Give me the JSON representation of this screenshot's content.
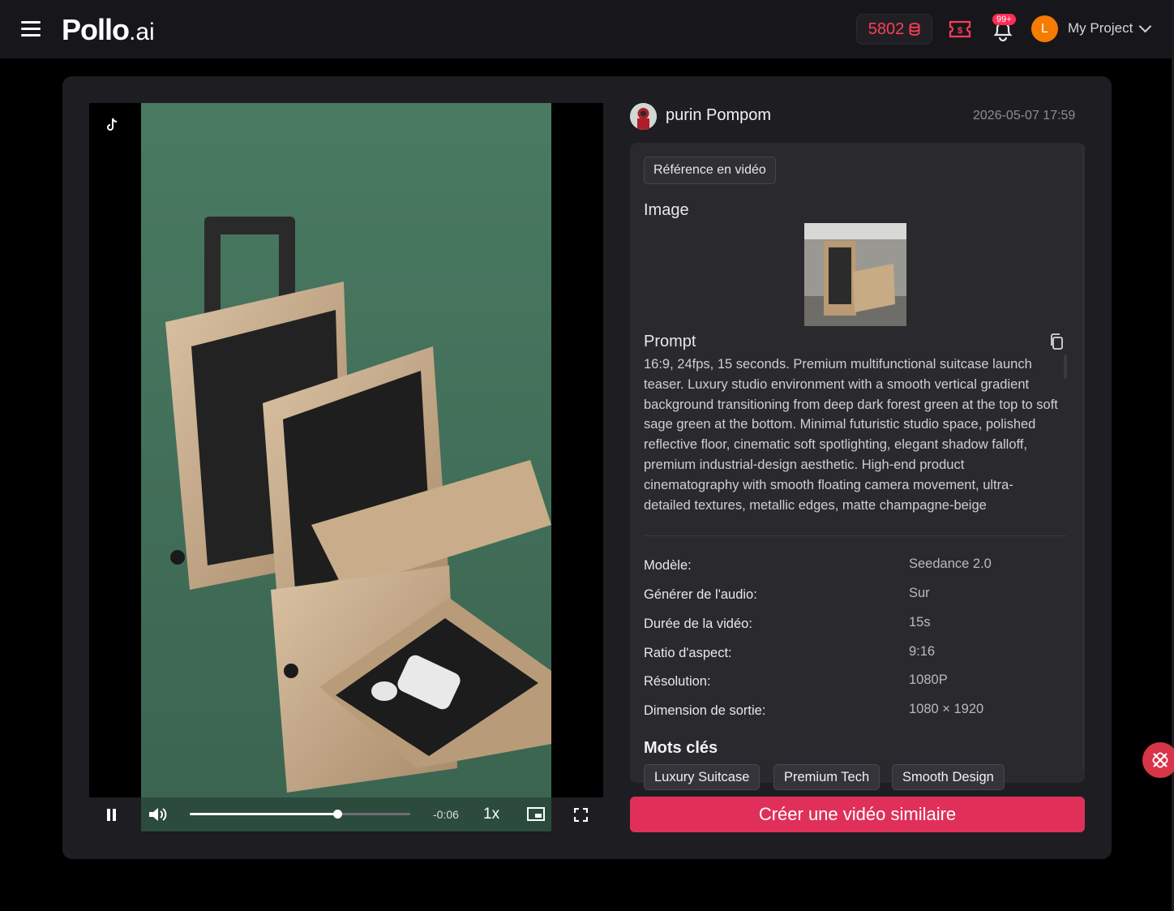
{
  "header": {
    "logo_main": "Pollo",
    "logo_ai": ".ai",
    "credits": "5802",
    "notifications_badge": "99+",
    "user_initial": "L",
    "project_label": "My Project"
  },
  "video": {
    "time_remaining": "-0:06",
    "speed": "1x",
    "progress": 0.67
  },
  "post": {
    "author": "purin Pompom",
    "date": "2026-05-07 17:59",
    "mode_tag": "Référence en vidéo",
    "image_label": "Image",
    "prompt_label": "Prompt",
    "prompt_text": "16:9, 24fps, 15 seconds. Premium multifunctional suitcase launch teaser. Luxury studio environment with a smooth vertical gradient background transitioning from deep dark forest green at the top to soft sage green at the bottom. Minimal futuristic studio space, polished reflective floor, cinematic soft spotlighting, elegant shadow falloff, premium industrial-design aesthetic. High-end product cinematography with smooth floating camera movement, ultra-detailed textures, metallic edges, matte champagne-beige"
  },
  "specs": [
    {
      "label": "Modèle:",
      "value": "Seedance 2.0"
    },
    {
      "label": "Générer de l'audio:",
      "value": "Sur"
    },
    {
      "label": "Durée de la vidéo:",
      "value": "15s"
    },
    {
      "label": "Ratio d'aspect:",
      "value": "9:16"
    },
    {
      "label": "Résolution:",
      "value": "1080P"
    },
    {
      "label": "Dimension de sortie:",
      "value": "1080 × 1920"
    }
  ],
  "keywords_title": "Mots clés",
  "keywords": [
    "Luxury Suitcase",
    "Premium Tech",
    "Smooth Design"
  ],
  "cta_label": "Créer une vidéo similaire",
  "colors": {
    "accent": "#e0305a",
    "credits": "#ff3d57",
    "avatar": "#f57c00",
    "video_bg": "#45715c"
  }
}
